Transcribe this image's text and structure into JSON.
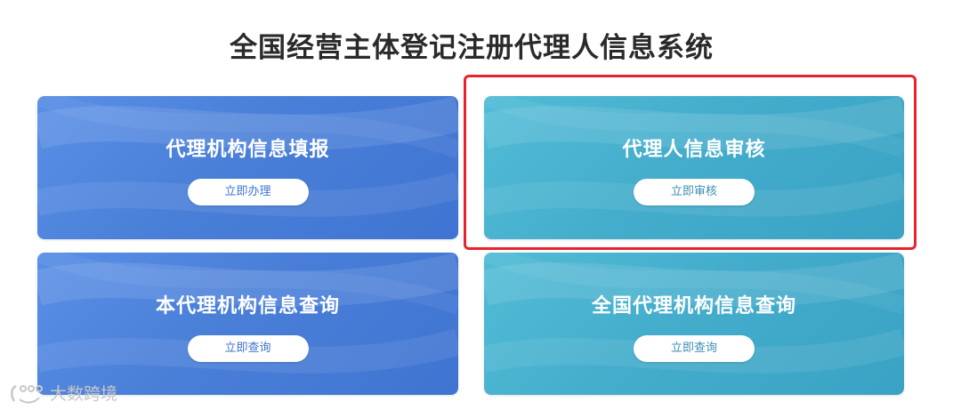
{
  "page": {
    "title": "全国经营主体登记注册代理人信息系统"
  },
  "cards": [
    {
      "title": "代理机构信息填报",
      "button": "立即办理",
      "color": "blue"
    },
    {
      "title": "代理人信息审核",
      "button": "立即审核",
      "color": "teal",
      "highlighted": true
    },
    {
      "title": "本代理机构信息查询",
      "button": "立即查询",
      "color": "blue"
    },
    {
      "title": "全国代理机构信息查询",
      "button": "立即查询",
      "color": "teal"
    }
  ],
  "colors": {
    "blue_card": "#4a7fd8",
    "teal_card": "#44adcc",
    "highlight_border": "#e8232b",
    "title_text": "#2a2a2a"
  },
  "watermark": {
    "text": "大数跨境",
    "icon": "watermark-logo-icon"
  }
}
